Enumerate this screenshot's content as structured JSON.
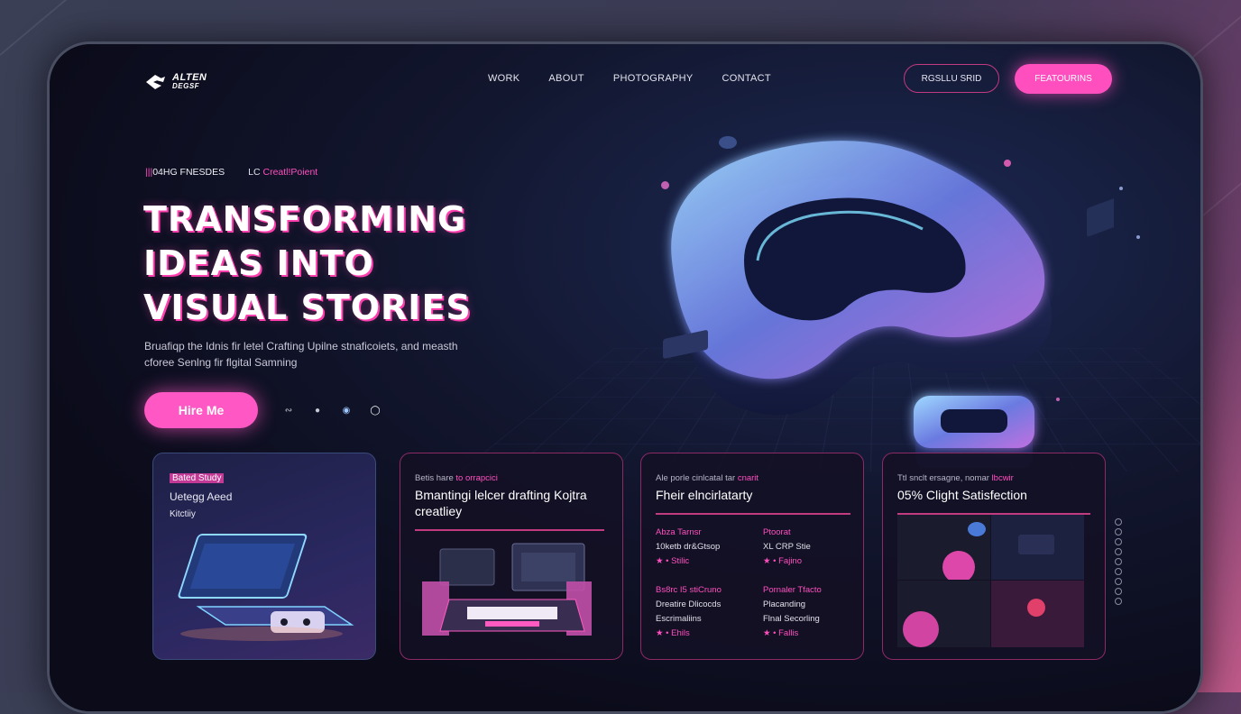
{
  "brand": {
    "name_line1": "ALTEN",
    "name_line2": "DEGSF"
  },
  "nav": {
    "items": [
      "WORK",
      "ABOUT",
      "PHOTOGRAPHY",
      "CONTACT"
    ]
  },
  "header_buttons": {
    "outline": "RGSLLU SRID",
    "primary": "FEATOURINS"
  },
  "hero": {
    "eyebrow_prefix": "|||",
    "eyebrow_main": "04HG FNESDES",
    "eyebrow_alt_prefix": "LC",
    "eyebrow_alt": "Creatl!Poient",
    "headline": [
      "TRANSFORMING",
      "IDEAS INTO",
      "VISUAL STORIES"
    ],
    "subtext": "Bruafiqp the Idnis fir letel Crafting Upilne stnaficoiets, and measth cforee Senlng fir flgital Samning",
    "cta": "Hire Me",
    "social_icons": [
      "link-icon",
      "chat-icon",
      "globe-icon",
      "dribbble-icon"
    ]
  },
  "cards": {
    "case": {
      "tag": "Bated Study",
      "line1": "Uetegg Aeed",
      "line2": "Kitctiiy"
    },
    "branding": {
      "label": "Betis hare ",
      "label_hi": "to orrapcici",
      "title": "Bmantingi lelcer drafting Kojtra creatliey"
    },
    "detail": {
      "label": "Ale porle cinlcatal tar ",
      "label_hi": "cnarit",
      "title": "Fheir elncirlatarty",
      "col1": [
        {
          "text": "Abza Tarnsr",
          "pink": true
        },
        {
          "text": "10ketb dr&Gtsop",
          "pink": false
        },
        {
          "text": "★ • Stilic",
          "pink": true
        },
        {
          "text": "",
          "pink": false
        },
        {
          "text": "Bs8rc I5 stiCruno",
          "pink": true
        },
        {
          "text": "Dreatire Dlicocds",
          "pink": false
        },
        {
          "text": "Escrimaliins",
          "pink": false
        },
        {
          "text": "★ • Ehils",
          "pink": true
        }
      ],
      "col2": [
        {
          "text": "Ptoorat",
          "pink": true
        },
        {
          "text": "XL CRP Stie",
          "pink": false
        },
        {
          "text": "★ • Fajino",
          "pink": true
        },
        {
          "text": "",
          "pink": false
        },
        {
          "text": "Pornaler Tfacto",
          "pink": true
        },
        {
          "text": "Placanding",
          "pink": false
        },
        {
          "text": "Flnal Secorling",
          "pink": false
        },
        {
          "text": "★ • Fallis",
          "pink": true
        }
      ]
    },
    "stats": {
      "label": "Ttl snclt ersagne, nomar ",
      "label_hi": "lbcwir",
      "title": "05% Clight Satisfection"
    }
  },
  "colors": {
    "accent": "#ff4fbf",
    "bg": "#0c0c1c",
    "glow": "#7fd4ff"
  }
}
